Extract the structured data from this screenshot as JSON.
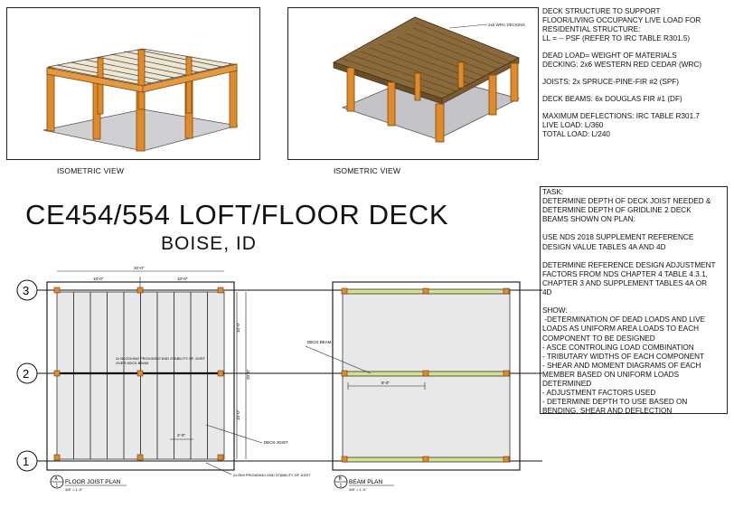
{
  "iso": {
    "left_caption": "ISOMETRIC VIEW",
    "right_caption": "ISOMETRIC VIEW",
    "decking_label": "2x6 WRC DECKING"
  },
  "notes": {
    "structure_1": "DECK STRUCTURE TO SUPPORT",
    "structure_2": "FLOOR/LIVING OCCUPANCY LIVE LOAD FOR",
    "structure_3": "RESIDENTIAL STRUCTURE:",
    "structure_4": "LL = -- PSF (REFER TO IRC TABLE R301.5)",
    "dead_1": "DEAD LOAD= WEIGHT OF MATERIALS",
    "dead_2": "DECKING: 2x6 WESTERN RED CEDAR (WRC)",
    "joists": "JOISTS: 2x SPRUCE-PINE-FIR #2 (SPF)",
    "beams": "DECK BEAMS: 6x DOUGLAS FIR #1 (DF)",
    "defl_1": "MAXIMUM DEFLECTIONS: IRC TABLE R301.7",
    "defl_2": "LIVE LOAD: L/360",
    "defl_3": "TOTAL LOAD: L/240"
  },
  "title": "CE454/554 LOFT/FLOOR DECK",
  "subtitle": "BOISE, ID",
  "task": {
    "lines": [
      "TASK:",
      "DETERMINE DEPTH OF DECK JOIST NEEDED &",
      "DETERMINE DEPTH OF GRIDLINE 2 DECK",
      "BEAMS SHOWN ON PLAN:",
      "",
      "USE NDS 2018 SUPPLEMENT REFERENCE",
      "DESIGN VALUE TABLES 4A AND 4D",
      "",
      "DETERMINE REFERENCE DESIGN ADJUSTMENT",
      "FACTORS FROM NDS CHAPTER 4 TABLE 4.3.1,",
      "CHAPTER 3 AND SUPPLEMENT TABLES 4A OR",
      "4D",
      "",
      "SHOW:",
      " -DETERMINATION OF DEAD LOADS AND LIVE",
      "LOADS AS UNIFORM AREA LOADS TO EACH",
      "COMPONENT TO BE DESIGNED",
      "- ASCE CONTROLING LOAD COMBINATION",
      "- TRIBUTARY WIDTHS OF EACH COMPONENT",
      "- SHEAR AND MOMENT DIAGRAMS OF EACH",
      "MEMBER BASED ON UNIFORM LOADS",
      "DETERMINED",
      "- ADJUSTMENT FACTORS USED",
      "- DETERMINE DEPTH TO USE BASED ON",
      "BENDING, SHEAR AND DEFLECTION"
    ]
  },
  "grid": {
    "g3": "3",
    "g2": "2",
    "g1": "1"
  },
  "floor_plan": {
    "dim_overall": "20'-0\"",
    "dim_left": "10'-0\"",
    "dim_right": "10'-0\"",
    "dim_vert_top": "10'-0\"",
    "dim_vert_bottom": "10'-0\"",
    "dim_vert_overall": "20'-0\"",
    "blocking_note_1": "2x BLOCKING PROVIDING END STABILITY OF JOIST",
    "blocking_note_2": "OVER DECK BEAM",
    "joist_spacing": "2'-0\"",
    "deck_joist": "DECK JOIST",
    "rim_note": "2x RIM PROVIDING END STABILITY OF JOIST",
    "tag_letter": "A",
    "tag_number": "1",
    "caption": "FLOOR JOIST PLAN",
    "scale": "3/8\" = 1'-0\""
  },
  "beam_plan": {
    "deck_beam": "DECK BEAM",
    "beam_spacing": "8'-0\"",
    "tag_letter": "B",
    "tag_number": "1",
    "caption": "BEAM PLAN",
    "scale": "3/8\" = 1'-0\""
  },
  "colors": {
    "post": "#e08a2a",
    "post_dark": "#b86a18",
    "joist": "#d9d9d9",
    "decking": "#8a6a3a",
    "floor": "#c8c8cc",
    "plan_fill": "#e8e8ea",
    "beam_highlight": "#d8e090"
  }
}
